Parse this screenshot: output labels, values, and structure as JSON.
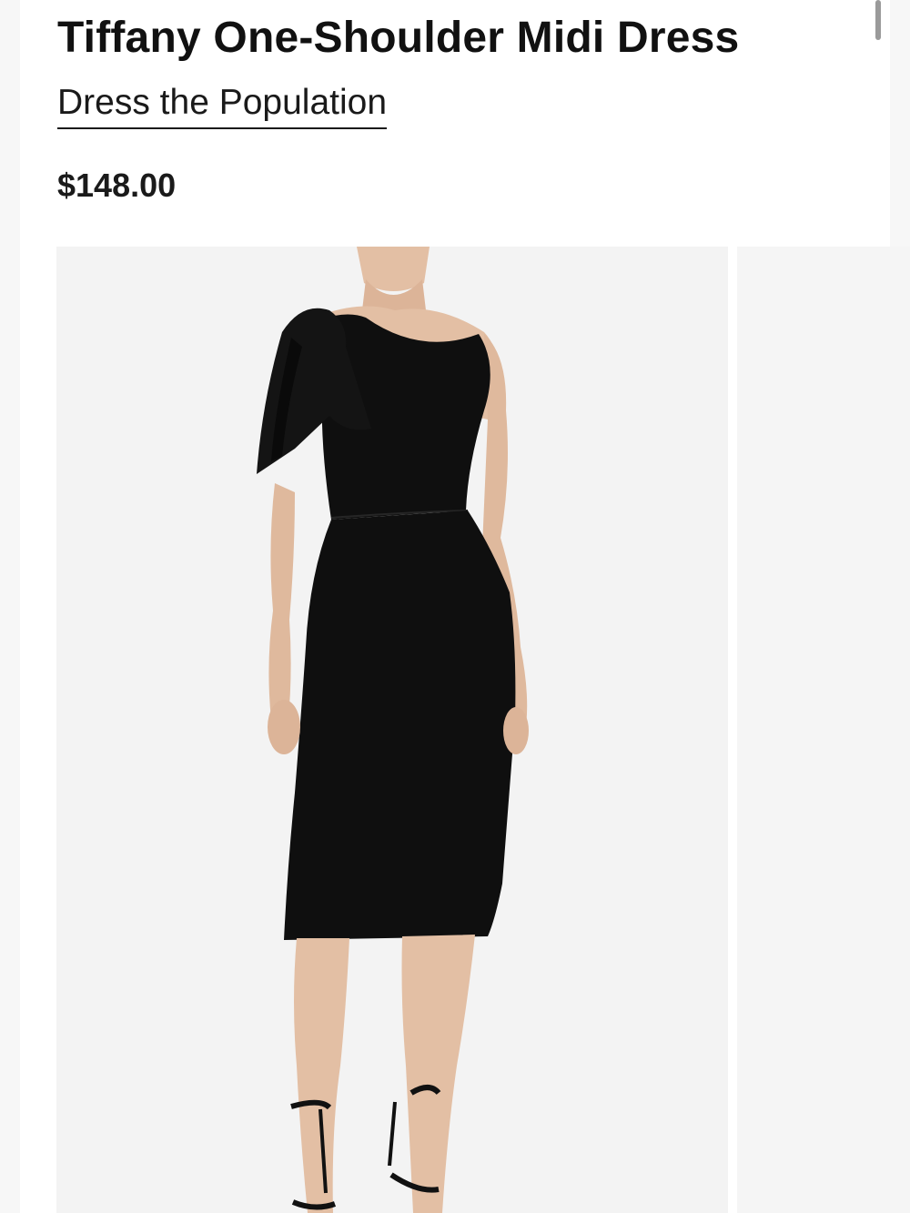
{
  "product": {
    "title": "Tiffany One-Shoulder Midi Dress",
    "brand": "Dress the Population",
    "price": "$148.00"
  },
  "gallery": {
    "images": [
      {
        "description_icon": "product-photo"
      },
      {
        "description_icon": "product-photo"
      }
    ]
  },
  "colors": {
    "dress": "#0f0f0f",
    "skin": "#e3bfa4",
    "photo_bg": "#f3f3f3"
  }
}
